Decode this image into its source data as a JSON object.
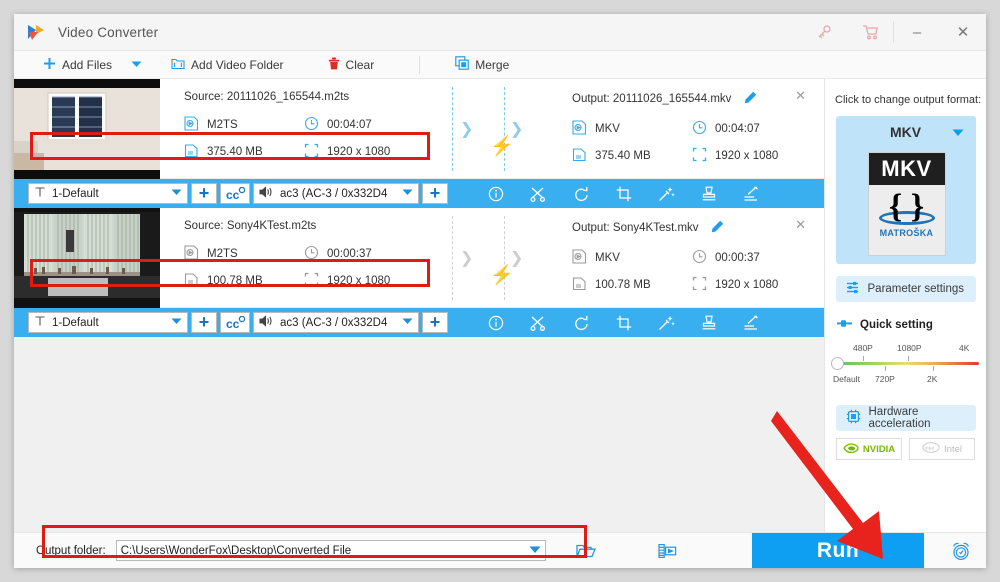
{
  "window": {
    "title": "Video Converter",
    "logo_icon": "wonderfox-play-logo",
    "key_icon": "key-icon",
    "cart_icon": "cart-icon",
    "minimize_label": "–",
    "close_label": "✕"
  },
  "toolbar": {
    "add_files": "Add Files",
    "add_files_icon": "plus-icon",
    "dropdown_icon": "chevron-down-icon",
    "add_video_folder": "Add Video Folder",
    "add_video_folder_icon": "folder-video-icon",
    "clear": "Clear",
    "clear_icon": "trash-icon",
    "merge": "Merge",
    "merge_icon": "merge-squares-icon"
  },
  "files": [
    {
      "thumbnail": "white-window-wall-frame",
      "source_label": "Source: 20111026_165544.m2ts",
      "src_format": "M2TS",
      "src_duration": "00:04:07",
      "src_size": "375.40 MB",
      "src_resolution": "1920 x 1080",
      "output_label": "Output: 20111026_165544.mkv",
      "out_format": "MKV",
      "out_duration": "00:04:07",
      "out_size": "375.40 MB",
      "out_resolution": "1920 x 1080",
      "edit_icon": "pencil-icon",
      "remove_icon": "close-icon",
      "convert_icon": "lightning-bolt-icon",
      "track": {
        "subtitle_value": "1-Default",
        "subtitle_icon": "subtitle-T-icon",
        "add_subtitle_icon": "plus-icon",
        "cc_icon": "closed-caption-icon",
        "audio_value": "ac3 (AC-3 / 0x332D4",
        "audio_icon": "speaker-icon",
        "add_audio_icon": "plus-icon",
        "tools": [
          "info-icon",
          "scissors-cut-icon",
          "rotate-icon",
          "crop-icon",
          "effects-wand-icon",
          "watermark-stamp-icon",
          "subtitle-edit-icon"
        ],
        "selected": true
      }
    },
    {
      "thumbnail": "window-with-vertical-blinds",
      "source_label": "Source: Sony4KTest.m2ts",
      "src_format": "M2TS",
      "src_duration": "00:00:37",
      "src_size": "100.78 MB",
      "src_resolution": "1920 x 1080",
      "output_label": "Output: Sony4KTest.mkv",
      "out_format": "MKV",
      "out_duration": "00:00:37",
      "out_size": "100.78 MB",
      "out_resolution": "1920 x 1080",
      "edit_icon": "pencil-icon",
      "remove_icon": "close-icon",
      "convert_icon": "lightning-bolt-icon",
      "track": {
        "subtitle_value": "1-Default",
        "subtitle_icon": "subtitle-T-icon",
        "add_subtitle_icon": "plus-icon",
        "cc_icon": "closed-caption-icon",
        "audio_value": "ac3 (AC-3 / 0x332D4",
        "audio_icon": "speaker-icon",
        "add_audio_icon": "plus-icon",
        "tools": [
          "info-icon",
          "scissors-cut-icon",
          "rotate-icon",
          "crop-icon",
          "effects-wand-icon",
          "watermark-stamp-icon",
          "subtitle-edit-icon"
        ],
        "selected": true
      }
    }
  ],
  "right_panel": {
    "format_prompt": "Click to change output format:",
    "format_name": "MKV",
    "format_caret_icon": "chevron-down-icon",
    "logo_top_text": "MKV",
    "logo_braces": "{ }",
    "logo_word": "MATROŠKA",
    "parameter_settings": "Parameter settings",
    "parameter_icon": "sliders-icon",
    "quick_setting": "Quick setting",
    "quick_setting_icon": "slider-handle-icon",
    "slider": {
      "top_labels": [
        "480P",
        "1080P",
        "4K"
      ],
      "bottom_labels": [
        "Default",
        "720P",
        "2K"
      ],
      "value": "Default"
    },
    "hardware_acceleration": "Hardware acceleration",
    "hardware_icon": "cpu-chip-icon",
    "gpus": [
      {
        "label": "NVIDIA",
        "icon": "nvidia-eye-icon",
        "enabled": true
      },
      {
        "label": "Intel",
        "icon": "intel-icon",
        "enabled": false
      }
    ]
  },
  "bottom": {
    "output_folder_label": "Output folder:",
    "output_folder_value": "C:\\Users\\WonderFox\\Desktop\\Converted File",
    "dropdown_icon": "chevron-down-icon",
    "open_folder_icon": "folder-open-icon",
    "output_preview_icon": "video-file-icon",
    "run_label": "Run",
    "alarm_icon": "alarm-clock-icon"
  },
  "annotations": {
    "arrow_color": "#e01b14",
    "highlight_color": "#e01b14"
  },
  "colors": {
    "accent": "#0e9ff2",
    "track_selected": "#39aff0",
    "panel_tint": "#bfe4fa",
    "bolt": "#f57c20"
  }
}
